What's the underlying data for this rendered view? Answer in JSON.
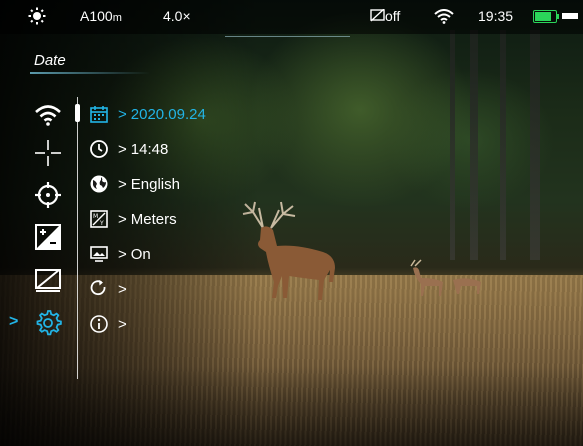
{
  "status": {
    "range": "A100",
    "range_unit": "m",
    "zoom": "4.0×",
    "recording": "off",
    "time": "19:35"
  },
  "menu": {
    "title": "Date",
    "left_icons": [
      "wifi-icon",
      "reticle-icon",
      "crosshair-target-icon",
      "exposure-icon",
      "display-off-icon",
      "settings-gear-icon"
    ],
    "items": [
      {
        "icon": "calendar-icon",
        "value": "2020.09.24"
      },
      {
        "icon": "clock-icon",
        "value": "14:48"
      },
      {
        "icon": "globe-icon",
        "value": "English"
      },
      {
        "icon": "units-icon",
        "value": "Meters"
      },
      {
        "icon": "screen-icon",
        "value": "On"
      },
      {
        "icon": "reset-icon",
        "value": ""
      },
      {
        "icon": "info-icon",
        "value": ""
      }
    ]
  },
  "colors": {
    "accent": "#22b4e6",
    "battery": "#2bd65a",
    "text": "#ffffff"
  }
}
